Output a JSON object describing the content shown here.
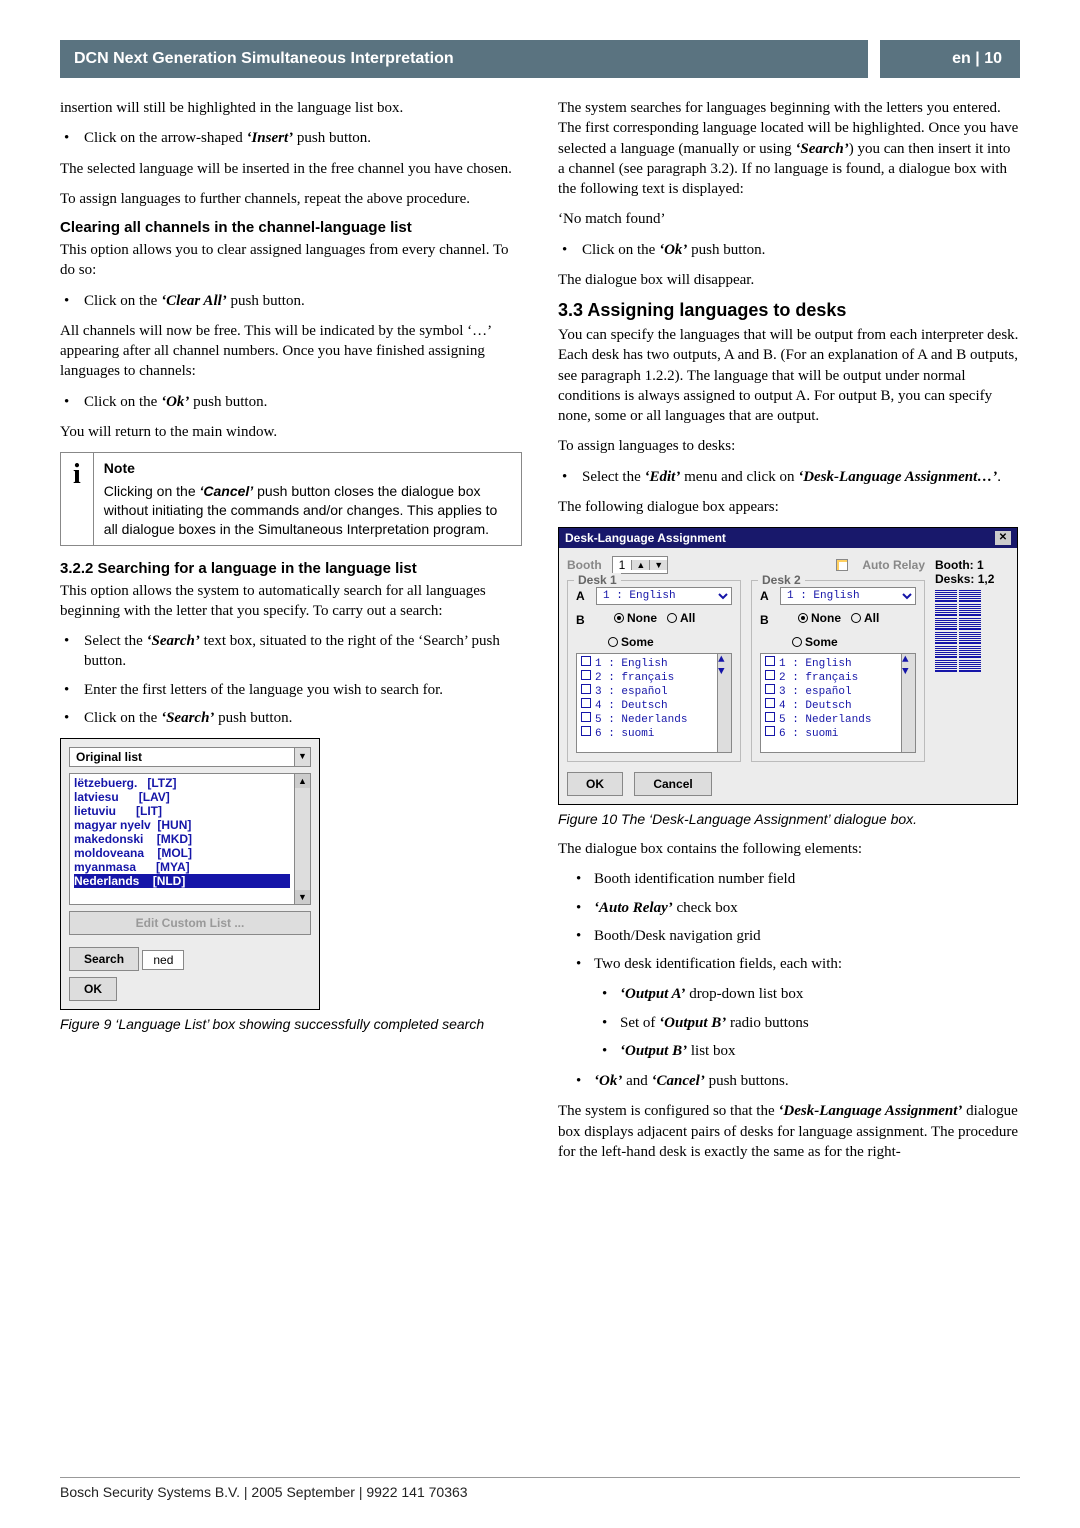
{
  "header": {
    "title": "DCN Next Generation Simultaneous Interpretation",
    "page": "en | 10"
  },
  "left": {
    "p1": "insertion will still be highlighted in the language list box.",
    "b1": [
      "Click on the arrow-shaped ",
      "‘Insert’",
      " push button."
    ],
    "p2": "The selected language will be inserted in the free channel you have chosen.",
    "p3": "To assign languages to further channels, repeat the above procedure.",
    "h1": "Clearing all channels in the channel-language list",
    "p4": "This option allows you to clear assigned languages from every channel. To do so:",
    "b2": [
      "Click on the ",
      "‘Clear All’",
      " push button."
    ],
    "p5": "All channels will now be free. This will be indicated by the symbol ‘…’ appearing after all channel numbers. Once you have finished assigning languages to channels:",
    "b3": [
      "Click on the ",
      "‘Ok’",
      " push button."
    ],
    "p6": "You will return to the main window.",
    "note": {
      "icon": "i",
      "label": "Note",
      "body": [
        "Clicking on the ",
        "‘Cancel’",
        " push button closes the dialogue box without initiating the commands and/or changes. This applies to all dialogue boxes in the Simultaneous Interpretation program."
      ]
    },
    "h2": "3.2.2  Searching for a language in the language list",
    "p7": "This option allows the system to automatically search for all languages beginning with the letter that you specify. To carry out a search:",
    "b4": [
      "Select the ",
      "‘Search’",
      " text box, situated to the right of the ‘Search’ push button."
    ],
    "b5": "Enter the first letters of the language you wish to search for.",
    "b6": [
      "Click on the ",
      "‘Search’",
      " push button."
    ],
    "fig9": {
      "combo": "Original list",
      "items": [
        "lëtzebuerg.   [LTZ]",
        "latviesu      [LAV]",
        "lietuviu      [LIT]",
        "magyar nyelv  [HUN]",
        "makedonski    [MKD]",
        "moldoveana    [MOL]",
        "myanmasa      [MYA]"
      ],
      "hil": "Nederlands    [NLD]",
      "edit": "Edit Custom List ...",
      "search": "Search",
      "input": "ned",
      "ok": "OK"
    },
    "fig9_cap": "Figure 9 ‘Language List’ box showing successfully completed search"
  },
  "right": {
    "p1": [
      "The system searches for languages beginning with the letters you entered. The first corresponding language located will be highlighted. Once you have selected a language (manually or using ",
      "‘Search’",
      ") you can then insert it into a channel (see paragraph 3.2). If no language is found, a dialogue box with the following text is displayed:"
    ],
    "p1b": "‘No match found’",
    "b1": [
      "Click on the ",
      "‘Ok’",
      " push button."
    ],
    "p2": "The dialogue box will disappear.",
    "h1": "3.3   Assigning languages to desks",
    "p3": "You can specify the languages that will be output from each interpreter desk. Each desk has two outputs, A and B. (For an explanation of A and B outputs, see paragraph 1.2.2). The language that will be output under normal conditions is always assigned to output A. For output B, you can specify none, some or all languages that are output.",
    "p4": "To assign languages to desks:",
    "b2": [
      "Select the ",
      "‘Edit’",
      " menu and click on ",
      "‘Desk-Language Assignment…’",
      "."
    ],
    "p5": "The following dialogue box appears:",
    "fig10": {
      "title": "Desk-Language Assignment",
      "booth": "Booth",
      "booth_n": "1",
      "auto": "Auto Relay",
      "side1": "Booth:   1",
      "side2": "Desks:  1,2",
      "desk1": "Desk 1",
      "desk2": "Desk 2",
      "a": "A",
      "b": "B",
      "sel": "1 : English",
      "none": "None",
      "all": "All",
      "some": "Some",
      "langs": [
        "1 : English",
        "2 : français",
        "3 : español",
        "4 : Deutsch",
        "5 : Nederlands",
        "6 : suomi"
      ],
      "ok": "OK",
      "cancel": "Cancel"
    },
    "fig10_cap": "Figure 10 The ‘Desk-Language Assignment’ dialogue box.",
    "p6": "The dialogue box contains the following elements:",
    "list_a": "Booth identification number field",
    "list_b": [
      "‘Auto Relay’",
      " check box"
    ],
    "list_c": "Booth/Desk navigation grid",
    "list_d": "Two desk identification fields, each with:",
    "sub_a": [
      "‘Output A’",
      " drop-down list box"
    ],
    "sub_b": [
      "Set of ",
      "‘Output B’",
      " radio buttons"
    ],
    "sub_c": [
      "‘Output B’",
      " list box"
    ],
    "list_e": [
      "‘Ok’",
      " and ",
      "‘Cancel’",
      " push buttons."
    ],
    "p7": [
      "The system is configured so that the ",
      "‘Desk-Language Assignment’",
      " dialogue box displays adjacent pairs of desks for language assignment. The procedure for the left-hand desk is exactly the same as for the right-"
    ]
  },
  "footer": "Bosch Security Systems B.V. | 2005 September | 9922 141 70363"
}
